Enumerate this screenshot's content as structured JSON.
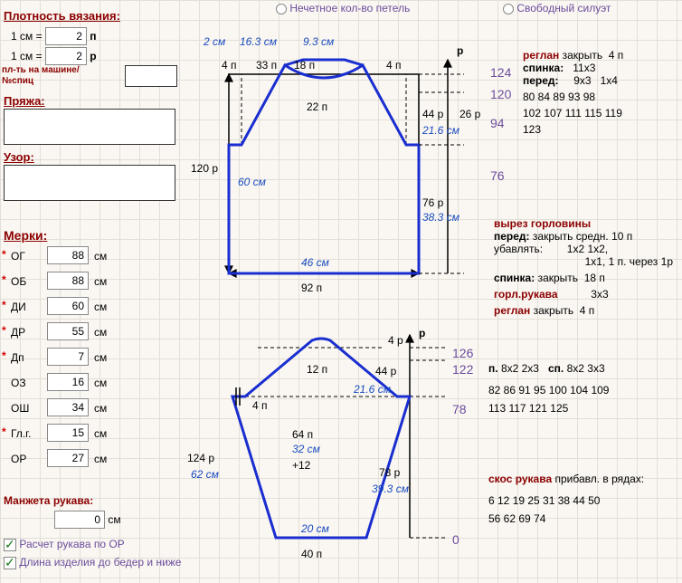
{
  "topRadios": {
    "r1": "Нечетное кол-во петель",
    "r2": "Свободный силуэт"
  },
  "density": {
    "title": "Плотность вязания:",
    "row1_left": "1 см =",
    "row1_val": "2",
    "row1_unit": "п",
    "row2_left": "1 см =",
    "row2_val": "2",
    "row2_unit": "р",
    "machine": "пл-ть на машине/",
    "needles": "№спиц",
    "yarn": "Пряжа:",
    "pattern": "Узор:"
  },
  "measures": {
    "title": "Мерки:",
    "rows": [
      {
        "key": "OG",
        "lbl": "ОГ",
        "val": "88",
        "unit": "см",
        "star": 1
      },
      {
        "key": "OB",
        "lbl": "ОБ",
        "val": "88",
        "unit": "см",
        "star": 1
      },
      {
        "key": "DI",
        "lbl": "ДИ",
        "val": "60",
        "unit": "см",
        "star": 1
      },
      {
        "key": "DR",
        "lbl": "ДР",
        "val": "55",
        "unit": "см",
        "star": 1
      },
      {
        "key": "DP",
        "lbl": "Дп",
        "val": "7",
        "unit": "см",
        "star": 1
      },
      {
        "key": "OZ",
        "lbl": "ОЗ",
        "val": "16",
        "unit": "см",
        "star": 0
      },
      {
        "key": "OSH",
        "lbl": "ОШ",
        "val": "34",
        "unit": "см",
        "star": 0
      },
      {
        "key": "GLG",
        "lbl": "Гл.г.",
        "val": "15",
        "unit": "см",
        "star": 1
      },
      {
        "key": "OR",
        "lbl": "ОР",
        "val": "27",
        "unit": "см",
        "star": 0
      }
    ],
    "cuff_label": "Манжета рукава:",
    "cuff_val": "0",
    "cuff_unit": "см",
    "check1": "Расчет рукава по ОР",
    "check2": "Длина изделия до бедер и ниже"
  },
  "body_diag": {
    "top_cm": {
      "a": "2 см",
      "b": "16.3 см",
      "c": "9.3 см"
    },
    "top_p": {
      "a": "4 п",
      "b": "33 п",
      "c": "18 п",
      "d": "4 п"
    },
    "neck": "22  п",
    "height_p_left": "120 р",
    "height_cm_left": "60 см",
    "bottom_cm": "46  см",
    "bottom_p": "92  п",
    "r_col_p_top": "44  р",
    "r_col_p_top2": "26 р",
    "r_cm_top": "21.6 см",
    "r_p_mid": "76   р",
    "r_cm_mid": "38.3 см",
    "p_label": "р",
    "levels_p": [
      "124",
      "120",
      "94",
      "76"
    ]
  },
  "sleeve_diag": {
    "top_right": "4 р",
    "top_right_p": "р",
    "levels": [
      "126",
      "122",
      "78",
      "0"
    ],
    "top_p": "12  п",
    "mid_left": "4 п",
    "mid_cm": "21.6 см",
    "mid_right": "44 р",
    "center_p": "64   п",
    "center_cm": "32 см",
    "center_plus": "+12",
    "left_p": "124  р",
    "left_cm": "62 см",
    "right_p": "78  р",
    "right_cm": "39.3 см",
    "bottom_cm": "20 см",
    "bottom_p": "40  п"
  },
  "right_block": {
    "reglan": "реглан",
    "reglan_txt": "закрыть",
    "reglan_n": "4  п",
    "spinka": "спинка:",
    "spinka_v": "11x3",
    "pered": "перед:",
    "pered_a": "9x3",
    "pered_b": "1x4",
    "line1": "80  84   89   93   98",
    "line2": "102  107  111  115  119",
    "line3": "123",
    "neck_title": "вырез горловины",
    "neck_pered": "перед:",
    "neck_pered_txt": "закрыть средн.",
    "neck_pered_n": "10  п",
    "ubav": "убавлять:",
    "ubav_v": "1x2 1x2,",
    "ubav2": "1x1, 1 п. через 1р",
    "neck_spinka": "спинка:",
    "neck_spinka_txt": "закрыть",
    "neck_spinka_n": "18  п",
    "gorl": "горл.рукава",
    "gorl_v": "3x3",
    "reglan2": "реглан",
    "reglan2_txt": "закрыть",
    "reglan2_n": "4  п",
    "pline": "п.",
    "pline_a": "8x2 2x3",
    "spline": "сп.",
    "spline_a": "8x2 3x3",
    "nline1": "82   86   91   95  100 104 109",
    "nline2": "113 117 121 125",
    "skos": "скос рукава",
    "skos_txt": "прибавл. в рядах:",
    "srow1": "6    12   19   25   31   38   44   50",
    "srow2": "56   62   69   74"
  }
}
